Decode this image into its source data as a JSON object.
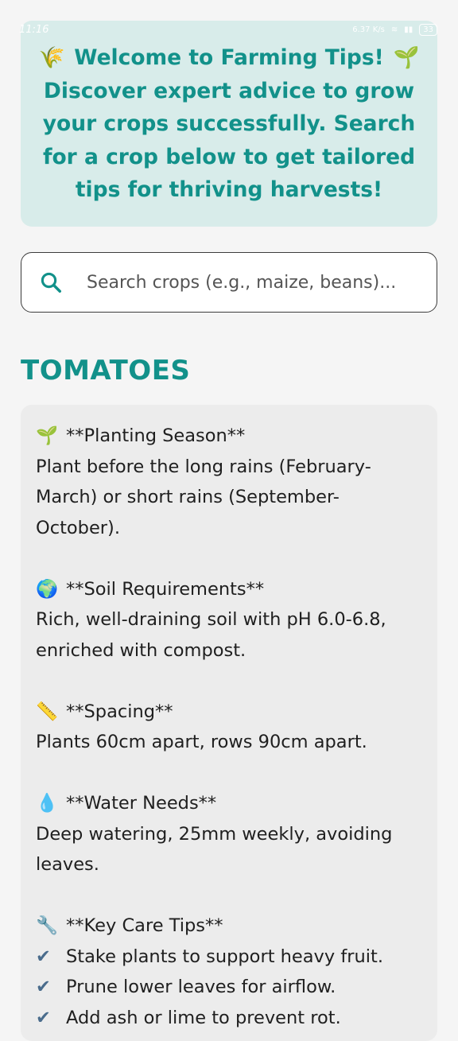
{
  "status_bar": {
    "time": "11:16",
    "network_speed": "6.37 K/s",
    "battery": "33"
  },
  "welcome": {
    "line1_emoji_left": "🌾",
    "line1_text": "Welcome to Farming Tips!",
    "line1_emoji_right": "🌱",
    "body": "Discover expert advice to grow your crops successfully. Search for a crop below to get tailored tips for thriving harvests!",
    "color": "#12918a",
    "background": "#d8ecea"
  },
  "search": {
    "placeholder": "Search crops (e.g., maize, beans)...",
    "value": "",
    "icon": "search-icon"
  },
  "crop": {
    "title": "TOMATOES",
    "sections": [
      {
        "emoji": "🌱",
        "heading": "**Planting Season**",
        "lines": [
          "Plant before the long rains (February-March) or short rains (September-October)."
        ]
      },
      {
        "emoji": "🌍",
        "heading": "**Soil Requirements**",
        "lines": [
          "Rich, well-draining soil with pH 6.0-6.8, enriched with compost."
        ]
      },
      {
        "emoji": "📏",
        "heading": "**Spacing**",
        "lines": [
          "Plants 60cm apart, rows 90cm apart."
        ]
      },
      {
        "emoji": "💧",
        "heading": "**Water Needs**",
        "lines": [
          "Deep watering, 25mm weekly, avoiding leaves."
        ]
      },
      {
        "emoji": "🔧",
        "heading": "**Key Care Tips**",
        "checks": [
          "Stake plants to support heavy fruit.",
          "Prune lower leaves for airflow.",
          "Add ash or lime to prevent rot."
        ],
        "check_symbol": "✔"
      }
    ]
  }
}
